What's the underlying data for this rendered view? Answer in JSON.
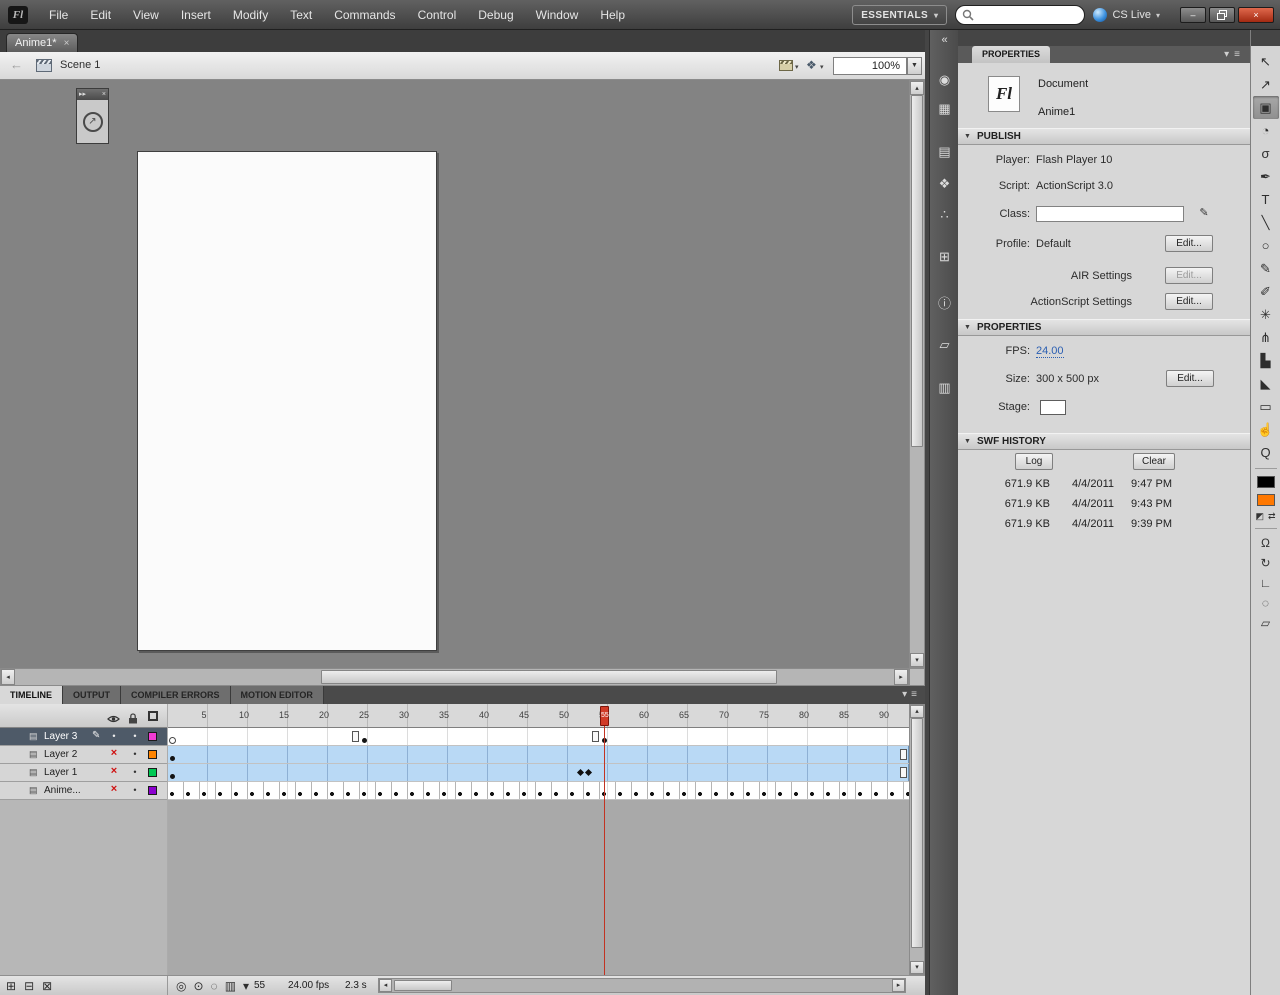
{
  "menubar": {
    "logo": "Fl",
    "items": [
      "File",
      "Edit",
      "View",
      "Insert",
      "Modify",
      "Text",
      "Commands",
      "Control",
      "Debug",
      "Window",
      "Help"
    ],
    "workspace": "ESSENTIALS",
    "search_placeholder": "",
    "cs_live": "CS Live"
  },
  "document_tab": {
    "label": "Anime1*"
  },
  "edit_bar": {
    "scene_label": "Scene 1",
    "zoom": "100%"
  },
  "icons": {
    "collapse": "▼",
    "caret": "▾",
    "close": "×",
    "minimize": "–",
    "expand_dock": "«",
    "panel_menu": "≡",
    "dropdown": "▼",
    "back": "←",
    "up": "▴",
    "down": "▾",
    "left": "◂",
    "right": "▸",
    "pencil": "✎",
    "symbols": "❖",
    "dot": "•",
    "layer_page": "▤",
    "mini_arrows": "▸▸",
    "curve_arrow": "↗",
    "black_white": "◩",
    "swap": "⇄"
  },
  "timeline": {
    "tabs": [
      {
        "label": "TIMELINE",
        "active": true
      },
      {
        "label": "OUTPUT",
        "active": false
      },
      {
        "label": "COMPILER ERRORS",
        "active": false
      },
      {
        "label": "MOTION EDITOR",
        "active": false
      }
    ],
    "ruler_numbers": [
      5,
      10,
      15,
      20,
      25,
      30,
      35,
      40,
      45,
      50,
      55,
      60,
      65,
      70,
      75,
      80,
      85,
      90
    ],
    "layers": [
      {
        "name": "Layer 3",
        "selected": true,
        "editing": true,
        "hidden": false,
        "color": "#f23bd4",
        "track": "keys"
      },
      {
        "name": "Layer 2",
        "selected": false,
        "editing": false,
        "hidden": true,
        "color": "#ff8400",
        "track": "tween"
      },
      {
        "name": "Layer 1",
        "selected": false,
        "editing": false,
        "hidden": true,
        "color": "#00c853",
        "track": "tween-diamonds"
      },
      {
        "name": "Anime...",
        "selected": false,
        "editing": false,
        "hidden": true,
        "color": "#8b00cf",
        "track": "series"
      }
    ],
    "layer3_markers": [
      {
        "type": "hollow",
        "frame": 1
      },
      {
        "type": "end",
        "frame": 24
      },
      {
        "type": "dot",
        "frame": 25
      },
      {
        "type": "end",
        "frame": 54
      },
      {
        "type": "dot",
        "frame": 55
      }
    ],
    "property_keyframes": [
      52,
      53
    ],
    "current_frame": "55",
    "frame_rate": "24.00 fps",
    "elapsed_time": "2.3 s",
    "layer_buttons": [
      {
        "name": "new-layer",
        "glyph": "⊞"
      },
      {
        "name": "new-folder",
        "glyph": "⊟"
      },
      {
        "name": "delete-layer",
        "glyph": "⊠"
      }
    ],
    "status_icons": [
      {
        "name": "center-frame",
        "glyph": "◎"
      },
      {
        "name": "onion-skin",
        "glyph": "⊙"
      },
      {
        "name": "onion-skin-outlines",
        "glyph": "◌"
      },
      {
        "name": "edit-multiple-frames",
        "glyph": "▥"
      },
      {
        "name": "modify-markers",
        "glyph": "▾"
      }
    ]
  },
  "dock": {
    "panels": [
      {
        "name": "color",
        "glyph": "◉"
      },
      {
        "name": "swatches",
        "glyph": "▦"
      },
      {
        "name": "code-snippets",
        "glyph": "▤"
      },
      {
        "name": "components",
        "glyph": "❖"
      },
      {
        "name": "motion-presets",
        "glyph": "∴"
      },
      {
        "name": "align",
        "glyph": "⊞"
      },
      {
        "name": "info",
        "glyph": "ⓘ"
      },
      {
        "name": "transform",
        "glyph": "▱"
      },
      {
        "name": "library",
        "glyph": "▥"
      }
    ]
  },
  "properties": {
    "tab": "PROPERTIES",
    "doc_icon": "Fl",
    "doc_type": "Document",
    "doc_name": "Anime1",
    "publish": {
      "header": "PUBLISH",
      "player_label": "Player:",
      "player_value": "Flash Player 10",
      "script_label": "Script:",
      "script_value": "ActionScript 3.0",
      "class_label": "Class:",
      "class_value": "",
      "profile_label": "Profile:",
      "profile_value": "Default",
      "edit_label": "Edit...",
      "air_label": "AIR Settings",
      "as_label": "ActionScript Settings"
    },
    "doc_props": {
      "header": "PROPERTIES",
      "fps_label": "FPS:",
      "fps_value": "24.00",
      "size_label": "Size:",
      "size_value": "300 x 500 px",
      "stage_label": "Stage:",
      "stage_color": "#ffffff"
    },
    "swf_history": {
      "header": "SWF HISTORY",
      "log_label": "Log",
      "clear_label": "Clear",
      "entries": [
        {
          "size": "671.9 KB",
          "date": "4/4/2011",
          "time": "9:47 PM"
        },
        {
          "size": "671.9 KB",
          "date": "4/4/2011",
          "time": "9:43 PM"
        },
        {
          "size": "671.9 KB",
          "date": "4/4/2011",
          "time": "9:39 PM"
        }
      ]
    }
  },
  "tools": {
    "stroke_color": "#000000",
    "fill_color": "#ff7800",
    "items": [
      {
        "name": "selection",
        "glyph": "↖"
      },
      {
        "name": "subselection",
        "glyph": "↗"
      },
      {
        "name": "free-transform",
        "glyph": "▣",
        "selected": true
      },
      {
        "name": "3d-rotation",
        "glyph": "◔"
      },
      {
        "name": "lasso",
        "glyph": "σ"
      },
      {
        "name": "pen",
        "glyph": "✒"
      },
      {
        "name": "text",
        "glyph": "T"
      },
      {
        "name": "line",
        "glyph": "╲"
      },
      {
        "name": "oval",
        "glyph": "○"
      },
      {
        "name": "pencil",
        "glyph": "✎"
      },
      {
        "name": "brush",
        "glyph": "✐"
      },
      {
        "name": "deco",
        "glyph": "✳"
      },
      {
        "name": "bone",
        "glyph": "⋔"
      },
      {
        "name": "paint-bucket",
        "glyph": "▙"
      },
      {
        "name": "eyedropper",
        "glyph": "◣"
      },
      {
        "name": "eraser",
        "glyph": "▭"
      },
      {
        "name": "hand",
        "glyph": "☝"
      },
      {
        "name": "zoom",
        "glyph": "Q"
      }
    ],
    "options": [
      {
        "name": "snap-magnet",
        "glyph": "Ω"
      },
      {
        "name": "rotate-and-skew",
        "glyph": "↻"
      },
      {
        "name": "scale",
        "glyph": "∟"
      },
      {
        "name": "envelope",
        "glyph": "◌"
      },
      {
        "name": "distort",
        "glyph": "▱"
      }
    ]
  }
}
